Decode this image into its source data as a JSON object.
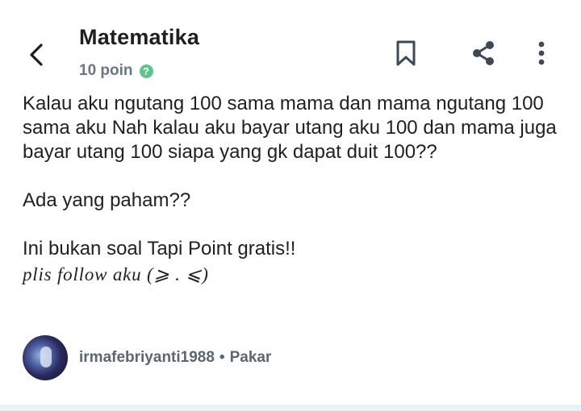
{
  "header": {
    "subject": "Matematika",
    "points": "10 poin"
  },
  "question": {
    "paragraph_1": "Kalau aku ngutang 100 sama mama dan mama ngutang 100 sama aku Nah kalau aku bayar utang aku 100 dan mama juga bayar utang 100 siapa yang gk dapat duit 100??",
    "paragraph_2": "Ada yang paham??",
    "paragraph_3": "Ini bukan soal Tapi Point gratis!!",
    "math_line": "plis follow aku (⩾ . ⩽)"
  },
  "author": {
    "username": "irmafebriyanti1988",
    "separator": "•",
    "rank": "Pakar"
  },
  "colors": {
    "help_icon": "#5fc48a",
    "muted_text": "#6a7782",
    "icon_stroke": "#3d4a56"
  },
  "icons": [
    "back-arrow-icon",
    "bookmark-icon",
    "share-icon",
    "more-vertical-icon",
    "help-icon"
  ]
}
